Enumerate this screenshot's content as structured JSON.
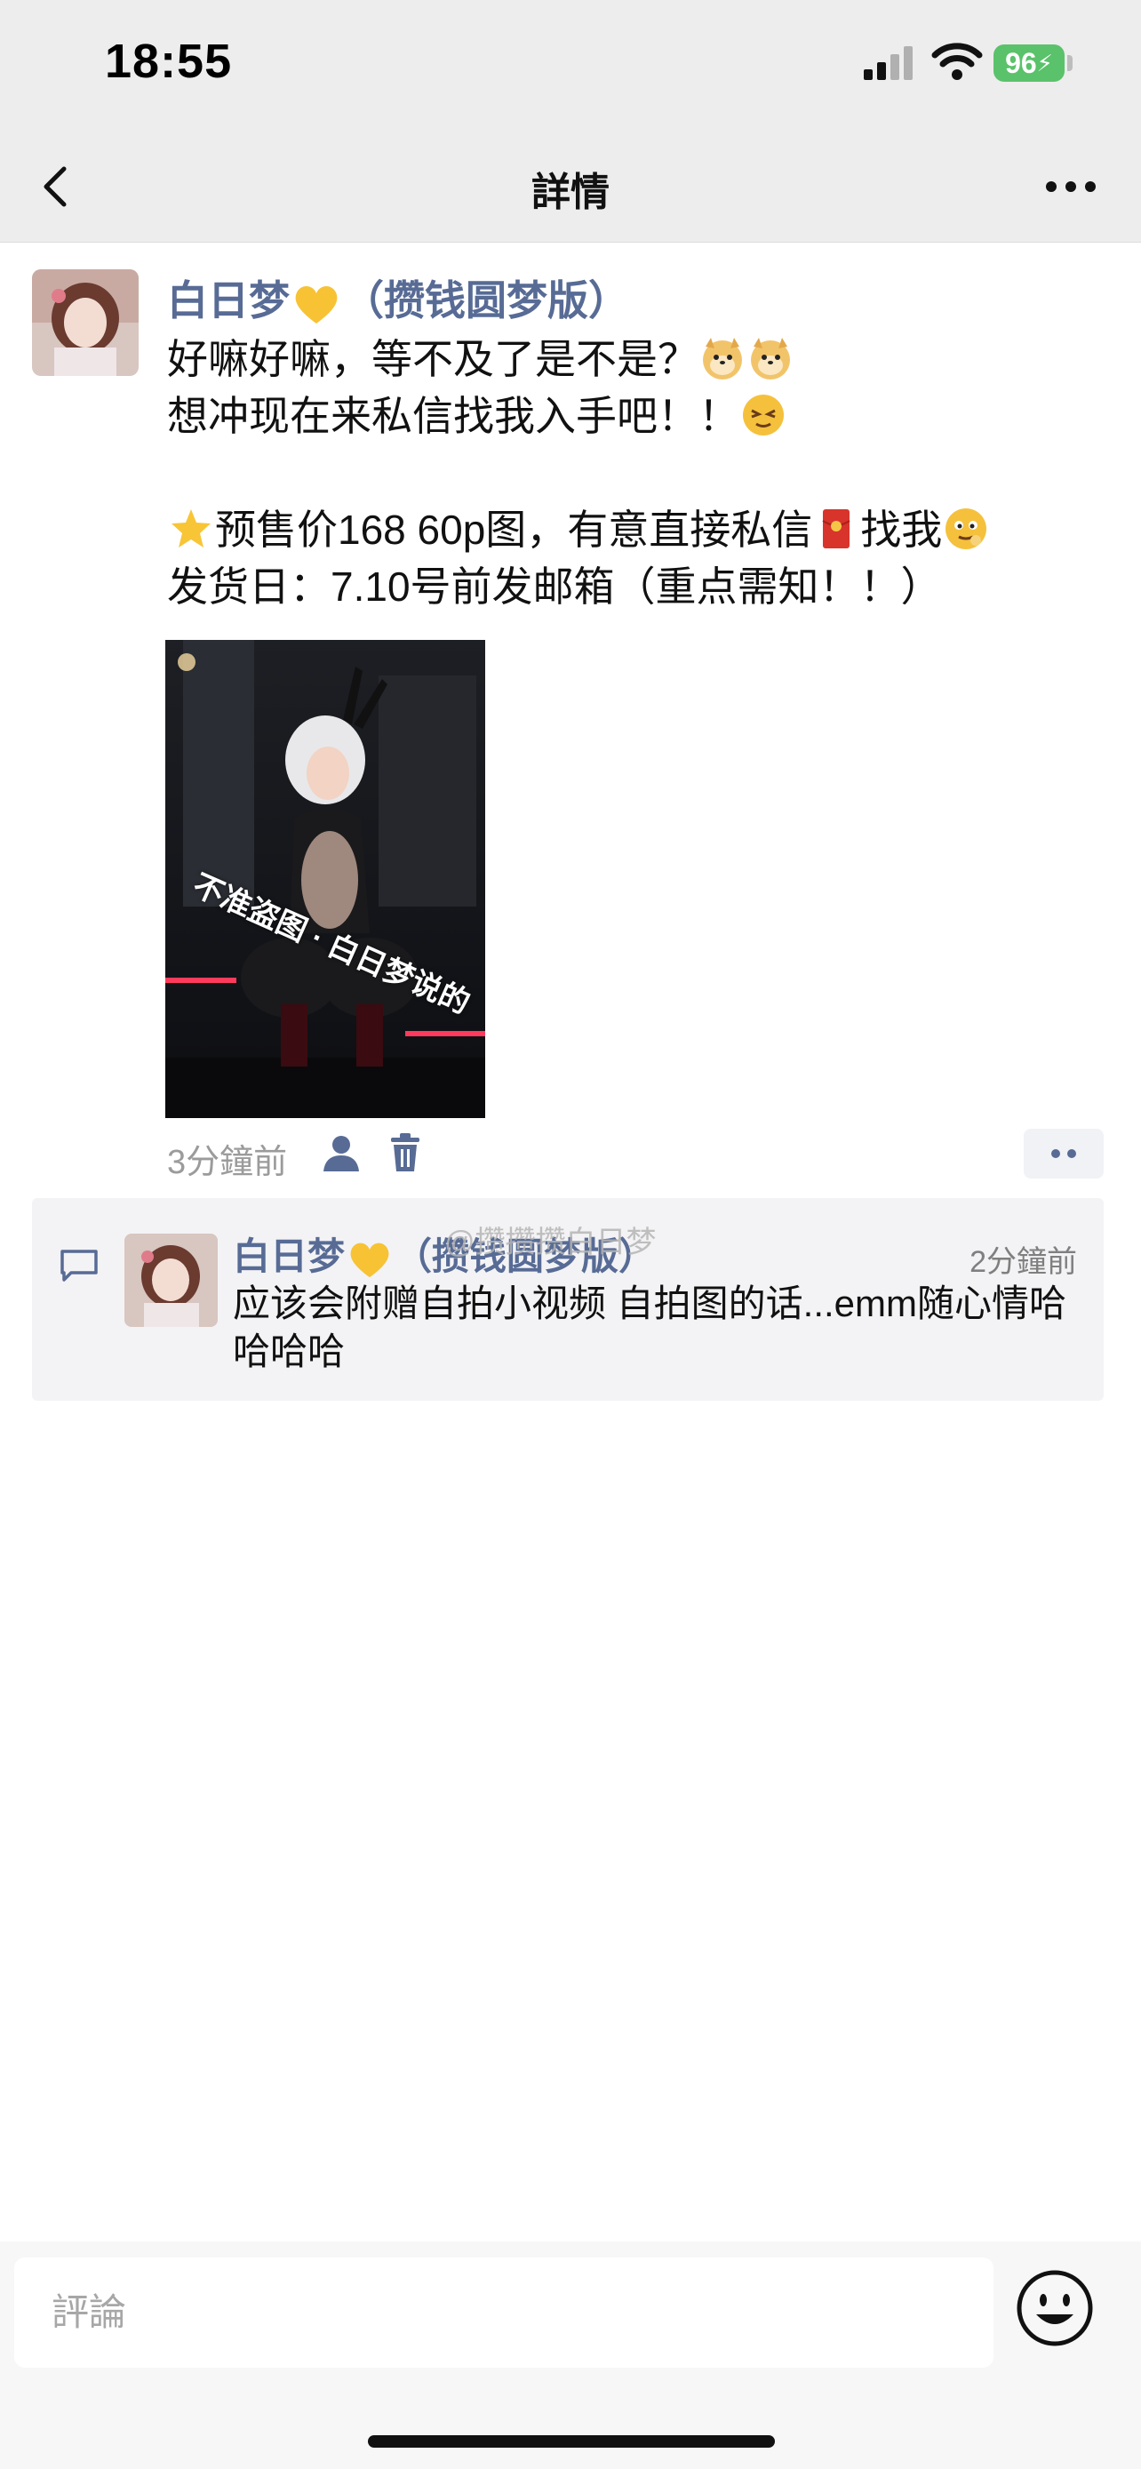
{
  "status": {
    "time": "18:55",
    "battery": "96"
  },
  "nav": {
    "title": "詳情"
  },
  "post": {
    "author": "白日梦",
    "author_suffix": "（攒钱圆梦版）",
    "line1": "好嘛好嘛，等不及了是不是？",
    "line2": "想冲现在来私信找我入手吧！！",
    "line3_a": "预售价168 60p图，有意直接私信",
    "line3_b": "找我",
    "line4": "发货日：7.10号前发邮箱（重点需知！！）",
    "image_watermark": "不准盗图 · 白日梦说的",
    "time": "3分鐘前"
  },
  "comment": {
    "author": "白日梦",
    "author_suffix": "（攒钱圆梦版）",
    "time": "2分鐘前",
    "text": "应该会附赠自拍小视频 自拍图的话...emm随心情哈哈哈哈",
    "overlay_watermark": "@攒攒攒白日梦"
  },
  "input": {
    "placeholder": "評論"
  },
  "colors": {
    "link": "#576b95",
    "battery": "#5ac26a",
    "background": "#ededed"
  },
  "icons": [
    "signal-icon",
    "wifi-icon",
    "back-chevron-icon",
    "more-dots-icon",
    "yellow-heart-icon",
    "doge-emoji-icon",
    "sly-emoji-icon",
    "star-emoji-icon",
    "red-envelope-icon",
    "blush-emoji-icon",
    "person-icon",
    "trash-icon",
    "comment-bubble-icon",
    "smiley-icon"
  ]
}
